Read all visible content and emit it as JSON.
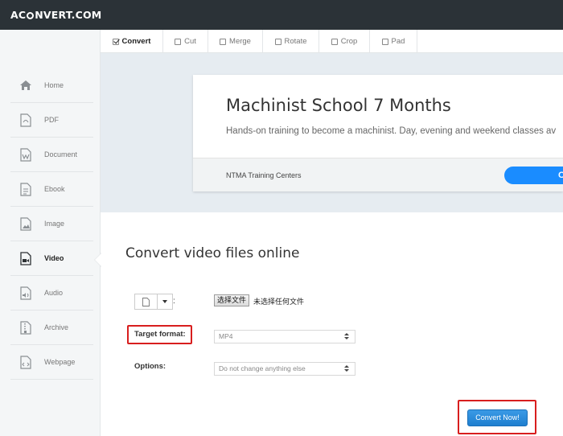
{
  "brand": {
    "logo_left": "AC",
    "logo_right": "NVERT.COM"
  },
  "sidebar": {
    "items": [
      {
        "label": "Home",
        "icon": "home-icon"
      },
      {
        "label": "PDF",
        "icon": "pdf-icon"
      },
      {
        "label": "Document",
        "icon": "document-icon"
      },
      {
        "label": "Ebook",
        "icon": "ebook-icon"
      },
      {
        "label": "Image",
        "icon": "image-icon"
      },
      {
        "label": "Video",
        "icon": "video-icon",
        "active": true
      },
      {
        "label": "Audio",
        "icon": "audio-icon"
      },
      {
        "label": "Archive",
        "icon": "archive-icon"
      },
      {
        "label": "Webpage",
        "icon": "webpage-icon"
      }
    ]
  },
  "tabs": [
    {
      "label": "Convert",
      "active": true
    },
    {
      "label": "Cut"
    },
    {
      "label": "Merge"
    },
    {
      "label": "Rotate"
    },
    {
      "label": "Crop"
    },
    {
      "label": "Pad"
    }
  ],
  "ad": {
    "title": "Machinist School 7 Months",
    "description": "Hands-on training to become a machinist. Day, evening and weekend classes av",
    "company": "NTMA Training Centers",
    "button_label": "O"
  },
  "main": {
    "title": "Convert video files online",
    "source": {
      "colon": ":",
      "file_button": "选择文件",
      "file_status": "未选择任何文件"
    },
    "target_format": {
      "label": "Target format:",
      "value": "MP4"
    },
    "options": {
      "label": "Options:",
      "value": "Do not change anything else"
    },
    "convert_button": "Convert Now!"
  },
  "colors": {
    "topbar": "#2b3237",
    "accent": "#1a8cff",
    "highlight": "#d81e1e"
  }
}
